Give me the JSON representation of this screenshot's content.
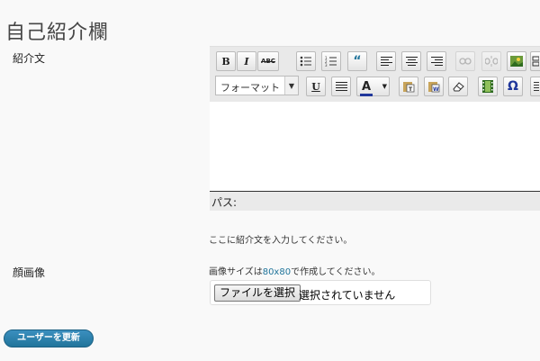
{
  "page": {
    "title": "自己紹介欄"
  },
  "bio": {
    "label": "紹介文",
    "path_label": "パス:",
    "hint": "ここに紹介文を入力してください。",
    "format_select": "フォーマット",
    "toolbar_row1": [
      "bold-icon",
      "italic-icon",
      "strikethrough-icon",
      "bullet-list-icon",
      "numbered-list-icon",
      "blockquote-icon",
      "align-left-icon",
      "align-center-icon",
      "align-right-icon",
      "link-icon",
      "unlink-icon",
      "insert-image-icon",
      "kitchen-sink-icon"
    ],
    "toolbar_row2": [
      "underline-icon",
      "justify-icon",
      "text-color-icon",
      "paste-text-icon",
      "paste-word-icon",
      "remove-format-icon",
      "media-icon",
      "special-char-icon",
      "outdent-icon"
    ]
  },
  "avatar": {
    "label": "顔画像",
    "hint_before": "画像サイズは",
    "hint_size": "80x80",
    "hint_after": "で作成してください。",
    "file_button": "ファイルを選択",
    "file_status": "選択されていません"
  },
  "submit": {
    "label": "ユーザーを更新"
  },
  "colors": {
    "accent": "#21759b",
    "toolbar_bg": "#e9e9e9",
    "page_bg": "#f9f9f9"
  }
}
